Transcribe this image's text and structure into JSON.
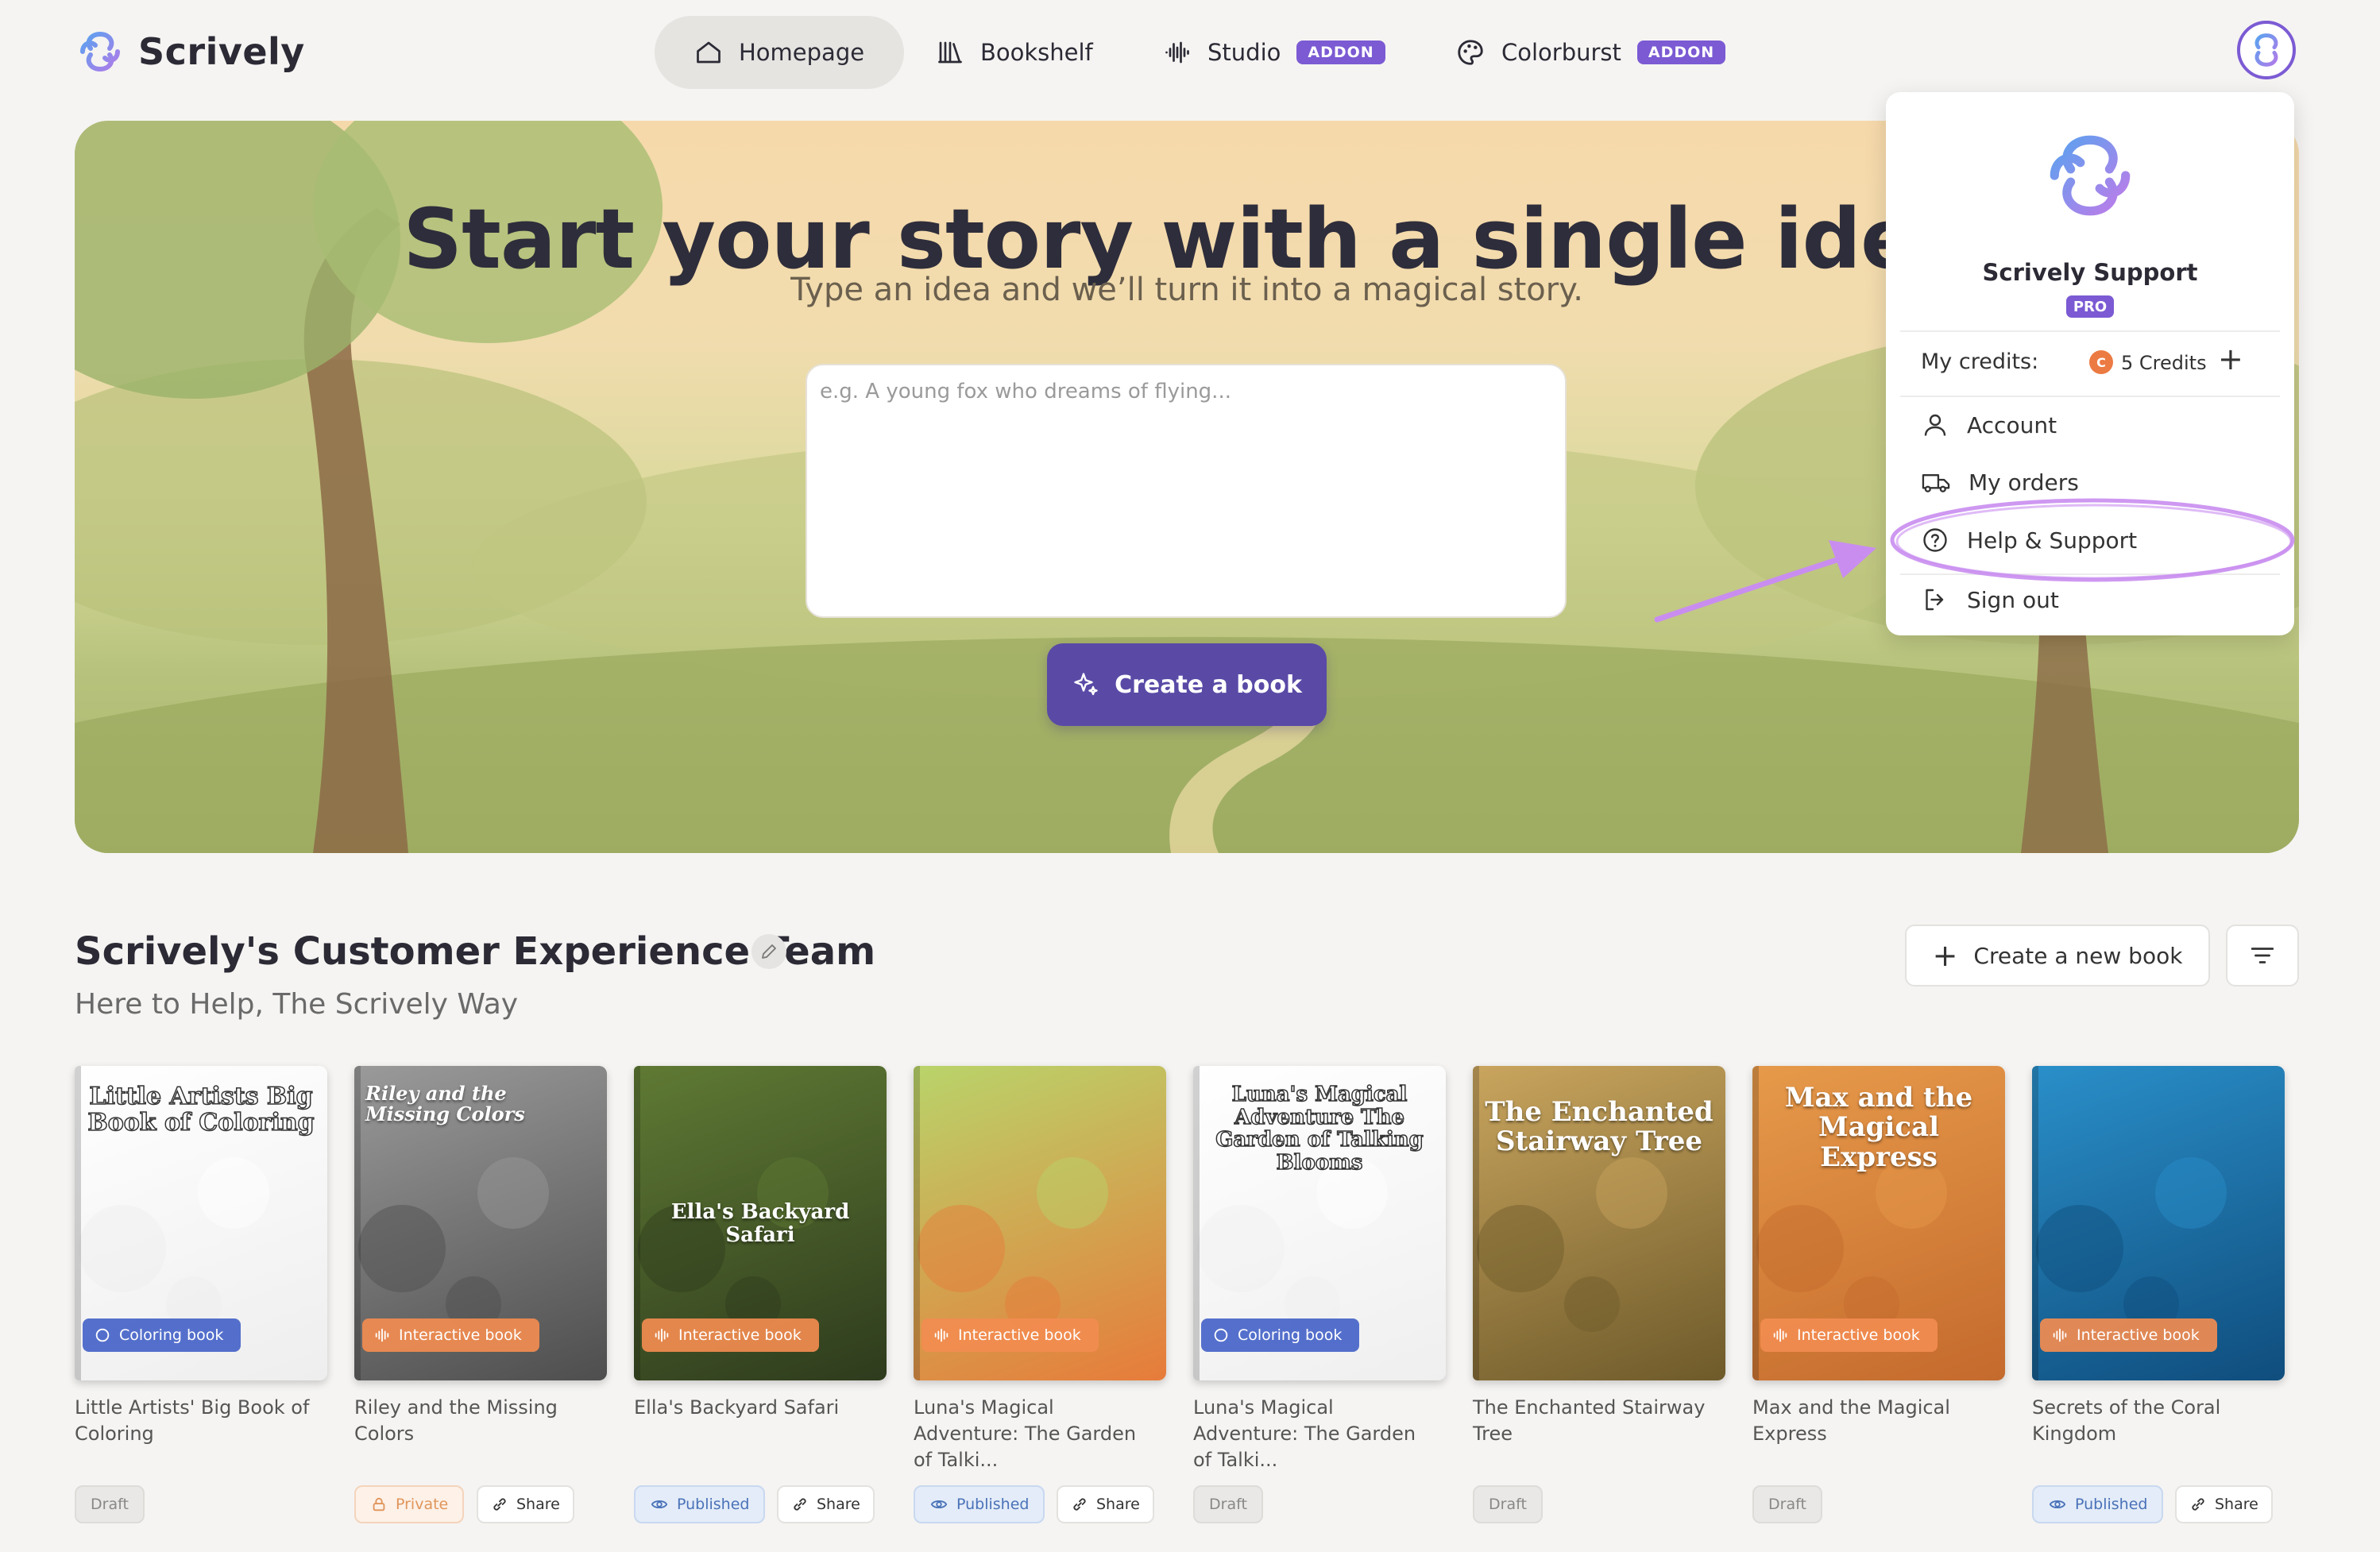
{
  "brand": {
    "name": "Scrively",
    "icon": "swirl-logo"
  },
  "nav": {
    "items": [
      {
        "label": "Homepage",
        "icon": "home-icon",
        "active": true
      },
      {
        "label": "Bookshelf",
        "icon": "books-icon"
      },
      {
        "label": "Studio",
        "icon": "audio-wave-icon",
        "badge": "ADDON"
      },
      {
        "label": "Colorburst",
        "icon": "palette-icon",
        "badge": "ADDON"
      }
    ]
  },
  "hero": {
    "title": "Start your story with a single idea",
    "subtitle": "Type an idea and we’ll turn it into a magical story.",
    "input_placeholder": "e.g. A young fox who dreams of flying...",
    "input_value": "",
    "button_label": "Create a book"
  },
  "user_menu": {
    "name": "Scrively Support",
    "plan_badge": "PRO",
    "credits_label": "My credits:",
    "credits_value": "5 Credits",
    "coin_letter": "C",
    "add_credits": "+",
    "items": [
      {
        "label": "Account",
        "icon": "user-icon"
      },
      {
        "label": "My orders",
        "icon": "truck-icon"
      },
      {
        "label": "Help & Support",
        "icon": "help-circle-icon",
        "highlighted": true
      },
      {
        "label": "Sign out",
        "icon": "sign-out-icon"
      }
    ]
  },
  "library": {
    "title": "Scrively's Customer Experience Team",
    "subtitle": "Here to Help, The Scrively Way",
    "new_book_label": "Create a new book",
    "new_book_icon": "+",
    "share_label": "Share",
    "books": [
      {
        "title": "Little Artists' Big Book of Coloring",
        "cover_title": "Little Artists Big Book of Coloring",
        "type": "Coloring book",
        "status": "Draft",
        "share": false,
        "colors": [
          "#ffffff",
          "#eeeeee"
        ]
      },
      {
        "title": "Riley and the Missing Colors",
        "cover_title": "Riley and the Missing Colors",
        "type": "Interactive book",
        "status": "Private",
        "share": true,
        "colors": [
          "#9a9a9a",
          "#4e4e4e"
        ]
      },
      {
        "title": "Ella's Backyard Safari",
        "cover_title": "Ella's Backyard Safari",
        "type": "Interactive book",
        "status": "Published",
        "share": true,
        "colors": [
          "#5f7a34",
          "#2e3b1d"
        ]
      },
      {
        "title": "Luna's Magical Adventure: The Garden of Talki...",
        "cover_title": "",
        "type": "Interactive book",
        "status": "Published",
        "share": true,
        "colors": [
          "#b9d46a",
          "#e77b3a"
        ]
      },
      {
        "title": "Luna's Magical Adventure: The Garden of Talki...",
        "cover_title": "Luna's Magical Adventure The Garden of Talking Blooms",
        "type": "Coloring book",
        "status": "Draft",
        "share": false,
        "colors": [
          "#ffffff",
          "#efefef"
        ]
      },
      {
        "title": "The Enchanted Stairway Tree",
        "cover_title": "The Enchanted Stairway Tree",
        "type": "",
        "status": "Draft",
        "share": false,
        "colors": [
          "#c9a55e",
          "#6e5a2a"
        ]
      },
      {
        "title": "Max and the Magical Express",
        "cover_title": "Max and the Magical Express",
        "type": "Interactive book",
        "status": "Draft",
        "share": false,
        "colors": [
          "#e79a4a",
          "#c46a2d"
        ]
      },
      {
        "title": "Secrets of the Coral Kingdom",
        "cover_title": "",
        "type": "Interactive book",
        "status": "Published",
        "share": true,
        "colors": [
          "#2a8fc9",
          "#0f4d7d"
        ]
      }
    ]
  },
  "colors": {
    "accent": "#5a4aa6",
    "badge": "#7b5ad3",
    "annotation": "#c98df0"
  }
}
